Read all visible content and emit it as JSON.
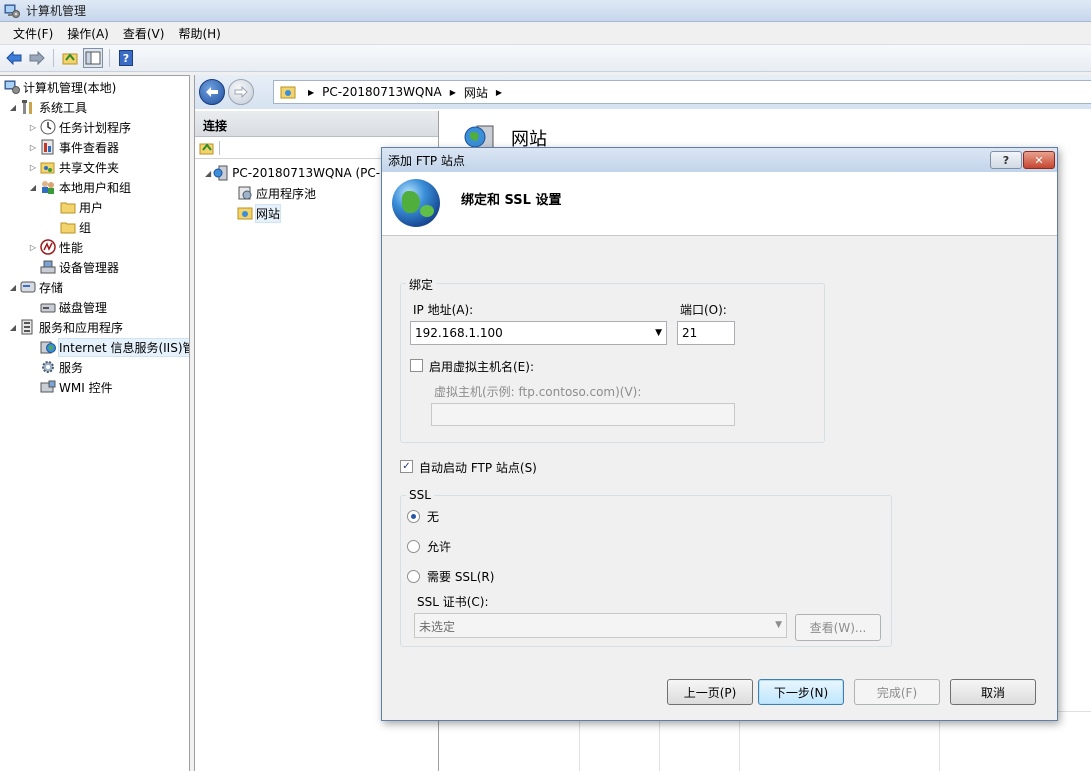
{
  "window": {
    "title": "计算机管理"
  },
  "menubar": [
    {
      "label": "文件(F)"
    },
    {
      "label": "操作(A)"
    },
    {
      "label": "查看(V)"
    },
    {
      "label": "帮助(H)"
    }
  ],
  "tree": {
    "root": "计算机管理(本地)",
    "items": [
      {
        "label": "系统工具",
        "icon": "tools-icon"
      },
      {
        "label": "任务计划程序",
        "icon": "clock-icon"
      },
      {
        "label": "事件查看器",
        "icon": "event-viewer-icon"
      },
      {
        "label": "共享文件夹",
        "icon": "shared-folder-icon"
      },
      {
        "label": "本地用户和组",
        "icon": "users-icon"
      },
      {
        "label": "用户",
        "icon": "folder-icon"
      },
      {
        "label": "组",
        "icon": "folder-icon"
      },
      {
        "label": "性能",
        "icon": "performance-icon"
      },
      {
        "label": "设备管理器",
        "icon": "device-manager-icon"
      },
      {
        "label": "存储",
        "icon": "storage-icon"
      },
      {
        "label": "磁盘管理",
        "icon": "disk-icon"
      },
      {
        "label": "服务和应用程序",
        "icon": "services-apps-icon"
      },
      {
        "label": "Internet 信息服务(IIS)管",
        "icon": "iis-icon"
      },
      {
        "label": "服务",
        "icon": "gear-icon"
      },
      {
        "label": "WMI 控件",
        "icon": "wmi-icon"
      }
    ]
  },
  "iis": {
    "breadcrumb": [
      "PC-20180713WQNA",
      "网站"
    ],
    "connections_header": "连接",
    "conn_tree": [
      {
        "label": "PC-20180713WQNA (PC-"
      },
      {
        "label": "应用程序池"
      },
      {
        "label": "网站"
      }
    ],
    "content_title": "网站"
  },
  "dialog": {
    "title": "添加 FTP 站点",
    "help_glyph": "?",
    "close_glyph": "✕",
    "heading": "绑定和 SSL 设置",
    "binding": {
      "legend": "绑定",
      "ip_label": "IP 地址(A):",
      "ip_value": "192.168.1.100",
      "port_label": "端口(O):",
      "port_value": "21",
      "virtual_host_checkbox": "启用虚拟主机名(E):",
      "virtual_host_checked": false,
      "virtual_host_label": "虚拟主机(示例: ftp.contoso.com)(V):",
      "virtual_host_value": ""
    },
    "auto_start": {
      "label": "自动启动 FTP 站点(S)",
      "checked": true
    },
    "ssl": {
      "legend": "SSL",
      "options": [
        "无",
        "允许",
        "需要 SSL(R)"
      ],
      "selected": "无",
      "cert_label": "SSL 证书(C):",
      "cert_value": "未选定",
      "view_button": "查看(W)..."
    },
    "buttons": {
      "prev": "上一页(P)",
      "next": "下一步(N)",
      "finish": "完成(F)",
      "cancel": "取消"
    }
  },
  "colors": {
    "accent": "#2b56a6",
    "selection": "#e5f1fb",
    "window_bg": "#f0f0f0"
  }
}
